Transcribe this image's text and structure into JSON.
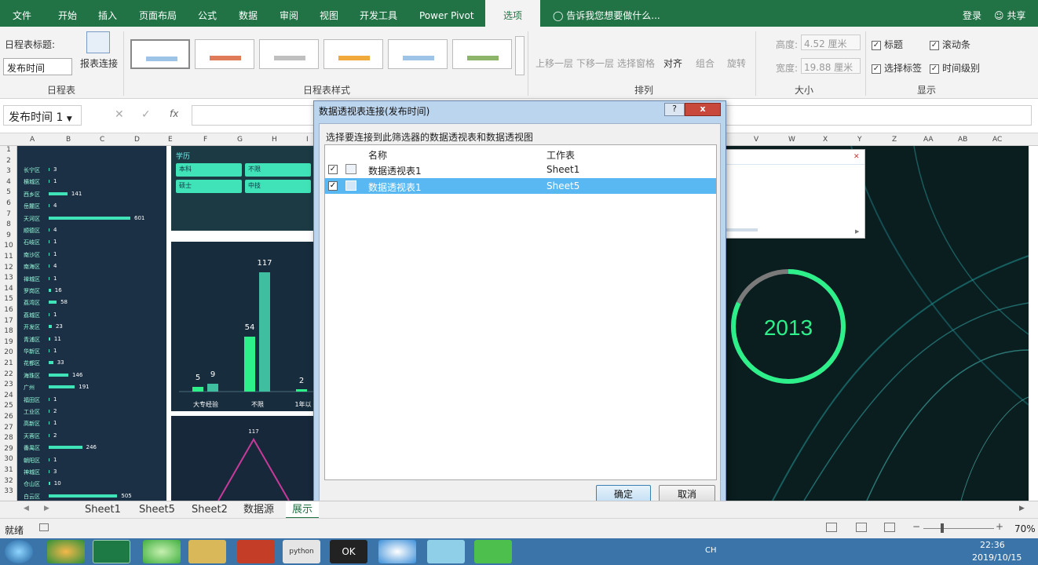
{
  "ribbon_tabs": [
    "文件",
    "开始",
    "插入",
    "页面布局",
    "公式",
    "数据",
    "审阅",
    "视图",
    "开发工具",
    "Power Pivot",
    "选项"
  ],
  "active_tab": "选项",
  "tell_me": "告诉我您想要做什么...",
  "login": "登录",
  "share": "共享",
  "timeline_group": {
    "title_label": "日程表标题:",
    "title_value": "发布时间",
    "report_conn": "报表连接",
    "group_label": "日程表"
  },
  "styles_group_label": "日程表样式",
  "arrange_group": {
    "items": [
      "上移一层",
      "下移一层",
      "选择窗格",
      "对齐",
      "组合",
      "旋转"
    ],
    "label": "排列"
  },
  "size_group": {
    "height_label": "高度:",
    "height_value": "4.52 厘米",
    "width_label": "宽度:",
    "width_value": "19.88 厘米",
    "label": "大小"
  },
  "show_group": {
    "items": [
      "标题",
      "滚动条",
      "选择标签",
      "时间级别"
    ],
    "label": "显示"
  },
  "formula_bar": {
    "name_box": "发布时间 1",
    "fx": "fx"
  },
  "column_headers": [
    "A",
    "B",
    "C",
    "D",
    "E",
    "F",
    "G",
    "H",
    "I",
    "V",
    "W",
    "X",
    "Y",
    "Z",
    "AA",
    "AB",
    "AC"
  ],
  "row_numbers": [
    "1",
    "2",
    "3",
    "4",
    "5",
    "6",
    "7",
    "8",
    "9",
    "10",
    "11",
    "12",
    "13",
    "14",
    "15",
    "16",
    "17",
    "18",
    "19",
    "20",
    "21",
    "22",
    "23",
    "24",
    "25",
    "26",
    "27",
    "28",
    "29",
    "30",
    "31",
    "32",
    "33"
  ],
  "district_bars": [
    {
      "name": "长宁区",
      "value": "3",
      "frac": 0.006
    },
    {
      "name": "横城区",
      "value": "1",
      "frac": 0.002
    },
    {
      "name": "西乡区",
      "value": "141",
      "frac": 0.23
    },
    {
      "name": "岳麓区",
      "value": "4",
      "frac": 0.007
    },
    {
      "name": "天河区",
      "value": "601",
      "frac": 1.0
    },
    {
      "name": "顺德区",
      "value": "4",
      "frac": 0.007
    },
    {
      "name": "石岐区",
      "value": "1",
      "frac": 0.002
    },
    {
      "name": "南沙区",
      "value": "1",
      "frac": 0.002
    },
    {
      "name": "南海区",
      "value": "4",
      "frac": 0.007
    },
    {
      "name": "禅城区",
      "value": "1",
      "frac": 0.002
    },
    {
      "name": "罗岗区",
      "value": "16",
      "frac": 0.027
    },
    {
      "name": "荔湾区",
      "value": "58",
      "frac": 0.097
    },
    {
      "name": "荔城区",
      "value": "1",
      "frac": 0.002
    },
    {
      "name": "开发区",
      "value": "23",
      "frac": 0.038
    },
    {
      "name": "青浦区",
      "value": "11",
      "frac": 0.018
    },
    {
      "name": "华新区",
      "value": "1",
      "frac": 0.002
    },
    {
      "name": "花都区",
      "value": "33",
      "frac": 0.055
    },
    {
      "name": "海珠区",
      "value": "146",
      "frac": 0.24
    },
    {
      "name": "广州",
      "value": "191",
      "frac": 0.32
    },
    {
      "name": "福田区",
      "value": "1",
      "frac": 0.002
    },
    {
      "name": "工业区",
      "value": "2",
      "frac": 0.003
    },
    {
      "name": "高新区",
      "value": "1",
      "frac": 0.002
    },
    {
      "name": "天蓉区",
      "value": "2",
      "frac": 0.003
    },
    {
      "name": "番禺区",
      "value": "246",
      "frac": 0.41
    },
    {
      "name": "朝阳区",
      "value": "1",
      "frac": 0.002
    },
    {
      "name": "神城区",
      "value": "3",
      "frac": 0.005
    },
    {
      "name": "仓山区",
      "value": "10",
      "frac": 0.017
    },
    {
      "name": "白云区",
      "value": "505",
      "frac": 0.84
    }
  ],
  "education_panel": {
    "title": "学历",
    "buttons": [
      "本科",
      "不限",
      "硕士",
      "中技"
    ]
  },
  "bar_chart": {
    "categories": [
      "大专经验",
      "不限",
      "1年以"
    ],
    "labels": [
      "5",
      "9",
      "54",
      "117",
      "2"
    ],
    "values": [
      5,
      9,
      54,
      117,
      2
    ]
  },
  "line_chart": {
    "peak_label": "117"
  },
  "ring": {
    "year": "2013",
    "progress": 0.82
  },
  "dialog": {
    "title": "数据透视表连接(发布时间)",
    "help": "?",
    "close": "x",
    "instruction": "选择要连接到此筛选器的数据透视表和数据透视图",
    "col_name": "名称",
    "col_sheet": "工作表",
    "rows": [
      {
        "name": "数据透视表1",
        "sheet": "Sheet1",
        "checked": true,
        "selected": false
      },
      {
        "name": "数据透视表1",
        "sheet": "Sheet5",
        "checked": true,
        "selected": true
      }
    ],
    "ok": "确定",
    "cancel": "取消"
  },
  "sheet_tabs": [
    "Sheet1",
    "Sheet5",
    "Sheet2",
    "数据源",
    "展示"
  ],
  "status": {
    "ready": "就绪",
    "zoom": "70%"
  },
  "taskbar": {
    "time": "22:36",
    "date": "2019/10/15",
    "lang": "CH",
    "python_label": "python",
    "ok_label": "OK"
  }
}
